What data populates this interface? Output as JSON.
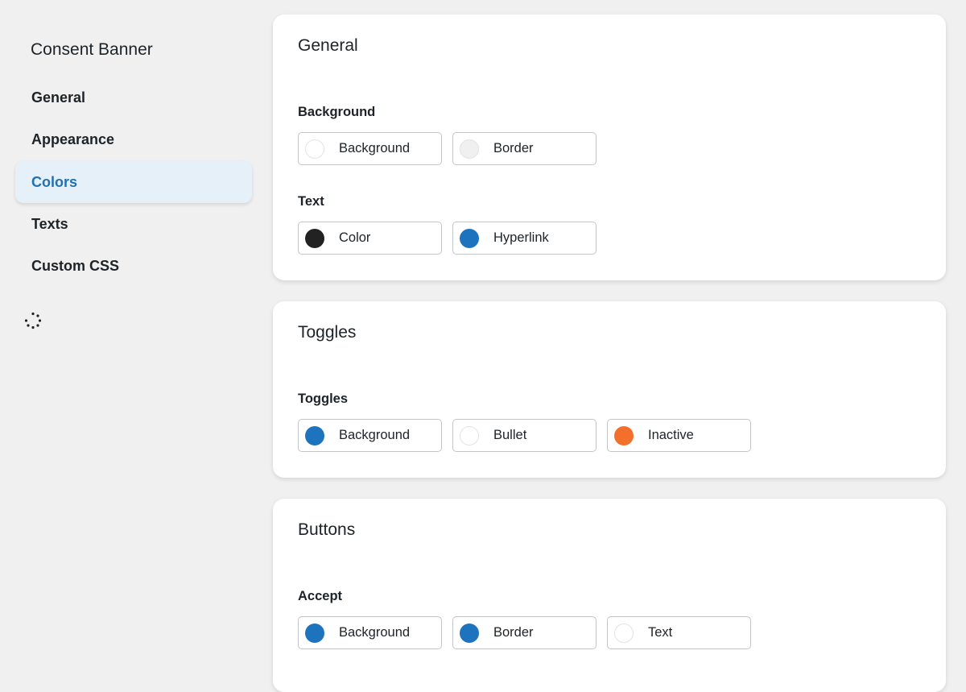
{
  "sidebar": {
    "title": "Consent Banner",
    "items": [
      {
        "label": "General"
      },
      {
        "label": "Appearance"
      },
      {
        "label": "Colors"
      },
      {
        "label": "Texts"
      },
      {
        "label": "Custom CSS"
      }
    ],
    "active": "Colors"
  },
  "sections": [
    {
      "title": "General",
      "groups": [
        {
          "label": "Background",
          "swatches": [
            {
              "label": "Background",
              "color": "#ffffff"
            },
            {
              "label": "Border",
              "color": "#f0f0f0"
            }
          ]
        },
        {
          "label": "Text",
          "swatches": [
            {
              "label": "Color",
              "color": "#222222"
            },
            {
              "label": "Hyperlink",
              "color": "#1e73be"
            }
          ]
        }
      ]
    },
    {
      "title": "Toggles",
      "groups": [
        {
          "label": "Toggles",
          "swatches": [
            {
              "label": "Background",
              "color": "#1e73be"
            },
            {
              "label": "Bullet",
              "color": "#ffffff"
            },
            {
              "label": "Inactive",
              "color": "#f36f2c"
            }
          ]
        }
      ]
    },
    {
      "title": "Buttons",
      "groups": [
        {
          "label": "Accept",
          "swatches": [
            {
              "label": "Background",
              "color": "#1e73be"
            },
            {
              "label": "Border",
              "color": "#1e73be"
            },
            {
              "label": "Text",
              "color": "#ffffff"
            }
          ]
        }
      ]
    }
  ],
  "colors": {
    "accent": "#2271b1",
    "active_bg": "#e5f0f9",
    "page_bg": "#f0f0f0"
  },
  "icons": {
    "loading": "spinner-icon"
  }
}
